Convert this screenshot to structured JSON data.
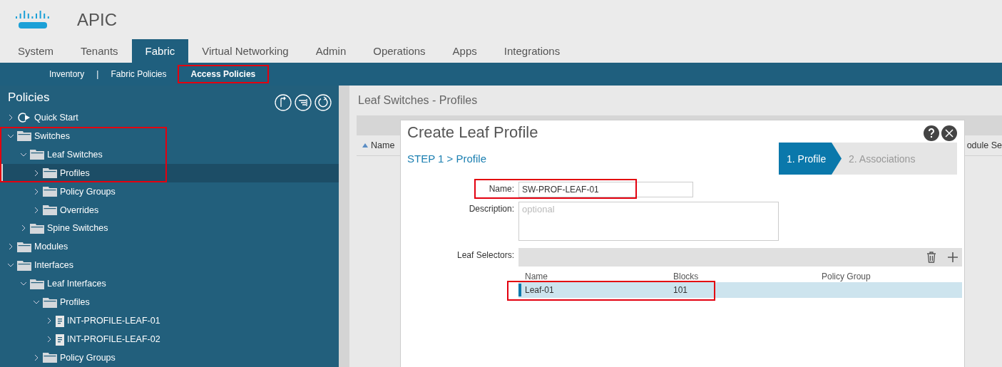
{
  "app": {
    "brand": "APIC"
  },
  "tabs": [
    {
      "label": "System",
      "selected": false
    },
    {
      "label": "Tenants",
      "selected": false
    },
    {
      "label": "Fabric",
      "selected": true
    },
    {
      "label": "Virtual Networking",
      "selected": false
    },
    {
      "label": "Admin",
      "selected": false
    },
    {
      "label": "Operations",
      "selected": false
    },
    {
      "label": "Apps",
      "selected": false
    },
    {
      "label": "Integrations",
      "selected": false
    }
  ],
  "subnav": [
    {
      "kind": "link",
      "label": "Inventory",
      "selected": false,
      "highlighted": false
    },
    {
      "kind": "separator",
      "label": "|"
    },
    {
      "kind": "link",
      "label": "Fabric Policies",
      "selected": false,
      "highlighted": false
    },
    {
      "kind": "link",
      "label": "Access Policies",
      "selected": true,
      "highlighted": true
    }
  ],
  "sidebar": {
    "title": "Policies",
    "tree": [
      {
        "label": "Quick Start",
        "kind": "quickstart",
        "expanded": false,
        "selected": false,
        "highlighted": false
      },
      {
        "label": "Switches",
        "kind": "folder",
        "expanded": true,
        "selected": false,
        "highlighted": true,
        "children": [
          {
            "label": "Leaf Switches",
            "kind": "folder",
            "expanded": true,
            "selected": false,
            "highlighted": true,
            "children": [
              {
                "label": "Profiles",
                "kind": "folder",
                "expanded": false,
                "selected": true,
                "highlighted": true
              },
              {
                "label": "Policy Groups",
                "kind": "folder",
                "expanded": false,
                "selected": false,
                "highlighted": false
              },
              {
                "label": "Overrides",
                "kind": "folder",
                "expanded": false,
                "selected": false,
                "highlighted": false
              }
            ]
          },
          {
            "label": "Spine Switches",
            "kind": "folder",
            "expanded": false,
            "selected": false,
            "highlighted": false
          }
        ]
      },
      {
        "label": "Modules",
        "kind": "folder",
        "expanded": false,
        "selected": false,
        "highlighted": false
      },
      {
        "label": "Interfaces",
        "kind": "folder",
        "expanded": true,
        "selected": false,
        "highlighted": false,
        "children": [
          {
            "label": "Leaf Interfaces",
            "kind": "folder",
            "expanded": true,
            "selected": false,
            "highlighted": false,
            "children": [
              {
                "label": "Profiles",
                "kind": "folder",
                "expanded": true,
                "selected": false,
                "highlighted": false,
                "children": [
                  {
                    "label": "INT-PROFILE-LEAF-01",
                    "kind": "document",
                    "expanded": false,
                    "selected": false,
                    "highlighted": false
                  },
                  {
                    "label": "INT-PROFILE-LEAF-02",
                    "kind": "document",
                    "expanded": false,
                    "selected": false,
                    "highlighted": false
                  }
                ]
              },
              {
                "label": "Policy Groups",
                "kind": "folder",
                "expanded": false,
                "selected": false,
                "highlighted": false
              }
            ]
          }
        ]
      }
    ]
  },
  "content": {
    "title": "Leaf Switches - Profiles",
    "columns": [
      "Name",
      "odule Se"
    ]
  },
  "dialog": {
    "title": "Create Leaf Profile",
    "step_label": "STEP 1 > Profile",
    "steps": [
      {
        "label": "1. Profile",
        "selected": true
      },
      {
        "label": "2. Associations",
        "selected": false
      }
    ],
    "name": {
      "label": "Name:",
      "value": "SW-PROF-LEAF-01",
      "highlighted": true
    },
    "description": {
      "label": "Description:",
      "placeholder": "optional"
    },
    "selectors": {
      "label": "Leaf Selectors:",
      "columns": [
        "Name",
        "Blocks",
        "Policy Group"
      ],
      "rows": [
        {
          "name": "Leaf-01",
          "blocks": "101",
          "selected": true,
          "highlighted": true
        }
      ]
    }
  }
}
